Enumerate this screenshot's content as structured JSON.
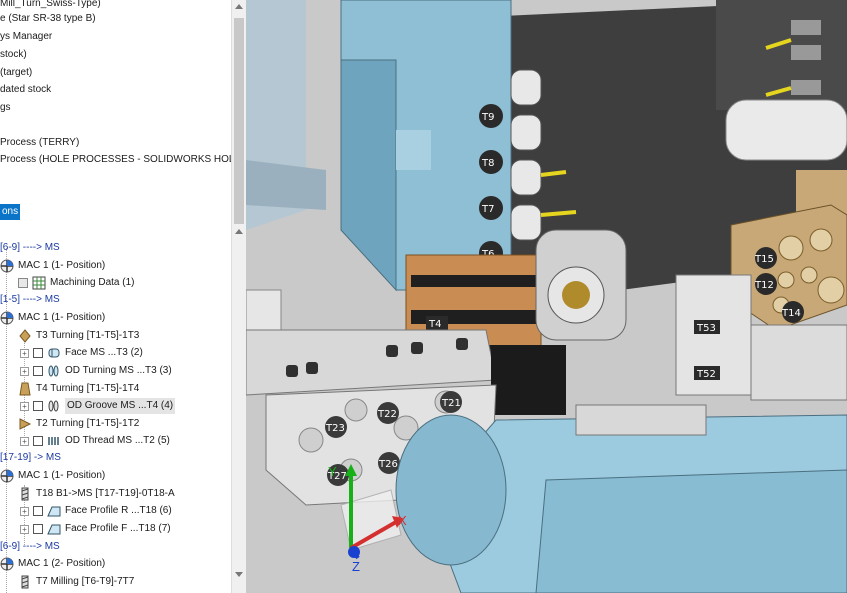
{
  "tree": {
    "r1": "Mill_Turn_Swiss-Type)",
    "r2": "e (Star SR-38 type B)",
    "r3": "ys Manager",
    "r4": "stock)",
    "r5": "(target)",
    "r6": "dated stock",
    "r7": "gs",
    "r8": "Process (TERRY)",
    "r9": "Process (HOLE PROCESSES - SOLIDWORKS HOLE WIZ",
    "r10": "ons",
    "r11": "[6-9] ----> MS",
    "r12": "MAC 1 (1- Position)",
    "r13": "Machining Data (1)",
    "r14": "[1-5] ----> MS",
    "r15": "MAC 1 (1- Position)",
    "r16": "T3 Turning [T1-T5]-1T3",
    "r17": "Face MS ...T3 (2)",
    "r18": "OD Turning MS ...T3 (3)",
    "r19": "T4 Turning [T1-T5]-1T4",
    "r20": "OD Groove MS ...T4 (4)",
    "r21": "T2 Turning [T1-T5]-1T2",
    "r22": "OD Thread MS ...T2 (5)",
    "r23": "[17-19] -> MS",
    "r24": "MAC 1 (1- Position)",
    "r25": "T18 B1->MS [T17-T19]-0T18-A",
    "r26": "Face Profile R ...T18 (6)",
    "r27": "Face Profile F ...T18 (7)",
    "r28": "[6-9] ----> MS",
    "r29": "MAC 1 (2- Position)",
    "r30": "T7 Milling [T6-T9]-7T7"
  },
  "viewport": {
    "tools": [
      "T9",
      "T8",
      "T7",
      "T6",
      "T4",
      "T15",
      "T12",
      "T14",
      "T53",
      "T52",
      "T23",
      "T22",
      "T21",
      "T26",
      "T27"
    ],
    "axes": {
      "x": "X",
      "y": "Y",
      "z": "Z"
    }
  },
  "colors": {
    "selection": "#0a74c9",
    "tool_block": "#8fbfd4",
    "bronze": "#c8a877"
  }
}
